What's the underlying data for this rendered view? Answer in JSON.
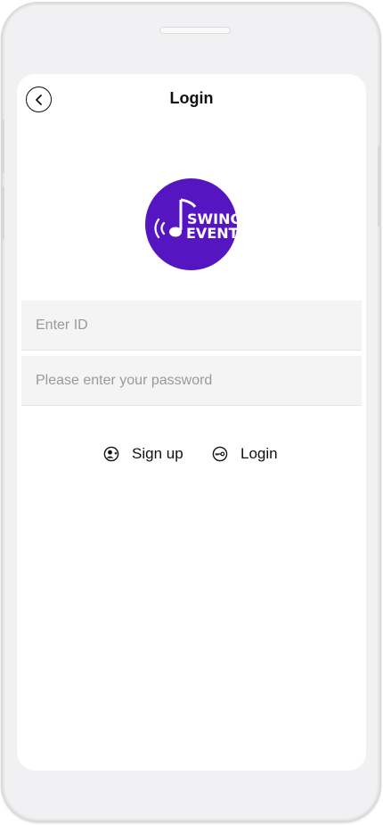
{
  "header": {
    "title": "Login"
  },
  "logo": {
    "line1": "SWING",
    "line2": "EVENT",
    "color": "#5516c2"
  },
  "form": {
    "id_placeholder": "Enter ID",
    "password_placeholder": "Please enter your password"
  },
  "actions": {
    "signup_label": "Sign up",
    "login_label": "Login"
  },
  "icons": {
    "back": "chevron-left-icon",
    "signup": "user-add-icon",
    "login": "key-icon"
  }
}
